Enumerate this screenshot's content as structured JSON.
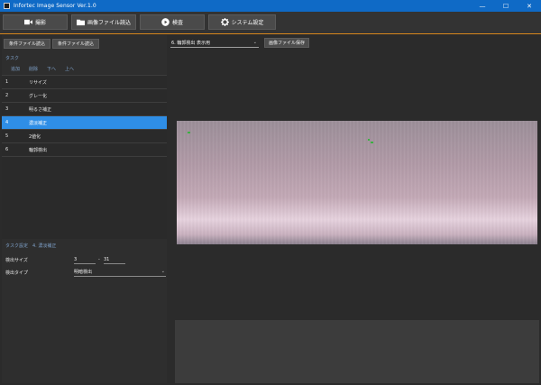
{
  "window": {
    "title": "Infortec Image Sensor  Ver.1.0",
    "minimize": "—",
    "maximize": "☐",
    "close": "✕"
  },
  "toolbar": {
    "capture": "撮影",
    "load_image": "画像ファイル読込",
    "inspect": "検査",
    "settings": "システム設定"
  },
  "left": {
    "cond_load_a": "条件ファイル読込",
    "cond_load_b": "条件ファイル読込",
    "task_section": "タスク",
    "actions": {
      "add": "追加",
      "remove": "削除",
      "down": "下へ",
      "up": "上へ"
    },
    "tasks": [
      {
        "num": "1",
        "name": "リサイズ"
      },
      {
        "num": "2",
        "name": "グレー化"
      },
      {
        "num": "3",
        "name": "明るさ補正"
      },
      {
        "num": "4",
        "name": "濃淡補正"
      },
      {
        "num": "5",
        "name": "2値化"
      },
      {
        "num": "6",
        "name": "輪郭検出"
      }
    ],
    "selected_index": 3,
    "task_settings_label": "タスク設定",
    "task_settings_name": "4. 濃淡補正",
    "detect_size_label": "検出サイズ",
    "detect_size_min": "3",
    "detect_size_sep": "-",
    "detect_size_max": "31",
    "detect_type_label": "検出タイプ",
    "detect_type_value": "明暗検出"
  },
  "main": {
    "view_select": "6. 輪郭検出 表示用",
    "save_image": "画像ファイル保存"
  },
  "colors": {
    "titlebar": "#0f6ac6",
    "accent_line": "#d8871c",
    "selected_row": "#2f8ee6",
    "section_label": "#7ea0c8"
  }
}
